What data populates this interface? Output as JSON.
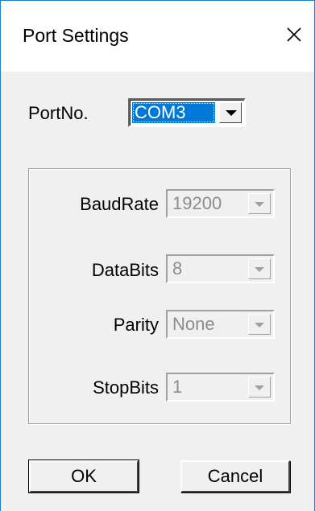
{
  "window": {
    "title": "Port Settings",
    "close_icon": "close-icon"
  },
  "port": {
    "label": "PortNo.",
    "value": "COM3"
  },
  "settings": {
    "baud": {
      "label": "BaudRate",
      "value": "19200"
    },
    "databits": {
      "label": "DataBits",
      "value": "8"
    },
    "parity": {
      "label": "Parity",
      "value": "None"
    },
    "stopbits": {
      "label": "StopBits",
      "value": "1"
    }
  },
  "buttons": {
    "ok": "OK",
    "cancel": "Cancel"
  },
  "colors": {
    "accent": "#1a7fd6",
    "selection": "#0078d7",
    "dialog_bg": "#f0f0f0",
    "disabled_text": "#8c8c8c"
  }
}
